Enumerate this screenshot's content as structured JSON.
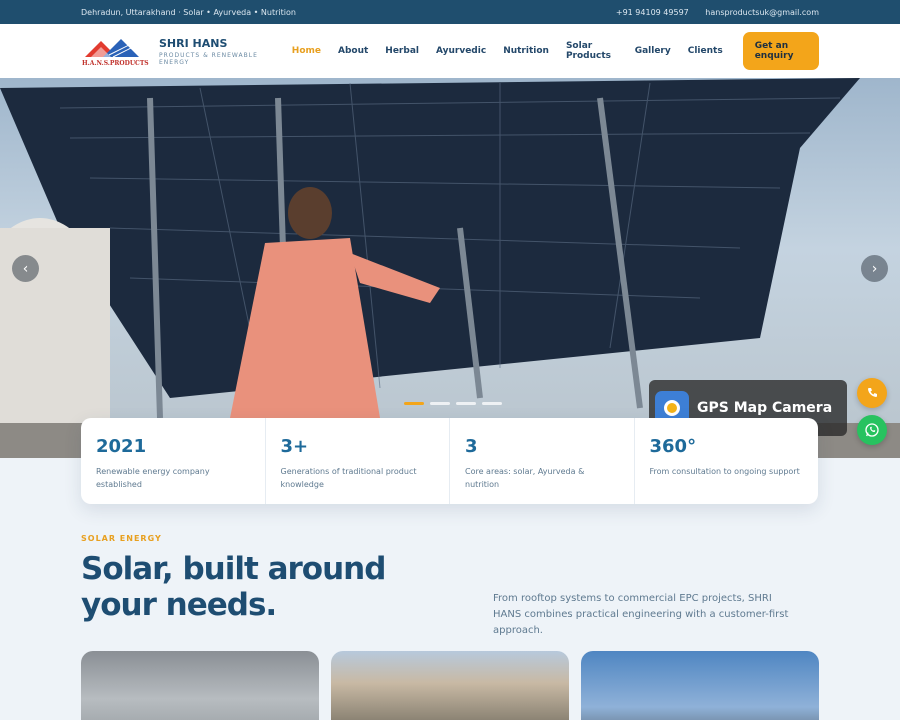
{
  "topbar": {
    "location": "Dehradun, Uttarakhand · Solar • Ayurveda • Nutrition",
    "phone": "+91 94109 49597",
    "email": "hansproductsuk@gmail.com"
  },
  "brand": {
    "logo_text": "H.A.N.S.PRODUCTS",
    "name": "SHRI HANS",
    "tagline": "PRODUCTS & RENEWABLE ENERGY"
  },
  "nav": {
    "items": [
      {
        "label": "Home"
      },
      {
        "label": "About"
      },
      {
        "label": "Herbal"
      },
      {
        "label": "Ayurvedic"
      },
      {
        "label": "Nutrition"
      },
      {
        "label": "Solar Products"
      },
      {
        "label": "Gallery"
      },
      {
        "label": "Clients"
      }
    ],
    "cta": "Get an enquiry"
  },
  "hero": {
    "prev": "‹",
    "next": "›",
    "watermark": "GPS Map Camera",
    "slide_count": 4,
    "active_slide": 1
  },
  "stats": [
    {
      "value": "2021",
      "desc": "Renewable energy company established"
    },
    {
      "value": "3+",
      "desc": "Generations of traditional product knowledge"
    },
    {
      "value": "3",
      "desc": "Core areas: solar, Ayurveda & nutrition"
    },
    {
      "value": "360°",
      "desc": "From consultation to ongoing support"
    }
  ],
  "section": {
    "label": "SOLAR ENERGY",
    "title": "Solar, built around your needs.",
    "desc": "From rooftop systems to commercial EPC projects, SHRI HANS combines practical engineering with a customer-first approach."
  },
  "floating": {
    "call_icon": "phone-icon",
    "whatsapp_icon": "whatsapp-icon"
  },
  "colors": {
    "primary": "#1e4d72",
    "accent": "#f3a51a",
    "topbar": "#1f4e6e",
    "whatsapp": "#27c25f"
  }
}
